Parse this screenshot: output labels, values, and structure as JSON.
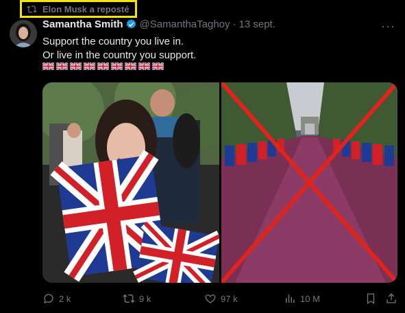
{
  "repost": {
    "label": "Elon Musk a reposté"
  },
  "tweet": {
    "author_name": "Samantha Smith",
    "handle": "@SamanthaTaghoy",
    "separator": "·",
    "date": "13 sept.",
    "line1": "Support the country you live in.",
    "line2": "Or live in the country you support.",
    "flag_count": 9
  },
  "colors": {
    "verified": "#1d9bf0",
    "highlight": "#f2e600",
    "muted": "#71767b",
    "cross": "#e0241b"
  },
  "icons": [
    "repost-icon",
    "verified-badge-icon",
    "more-icon",
    "reply-icon",
    "retweet-icon",
    "like-icon",
    "views-icon",
    "bookmark-icon",
    "share-icon"
  ],
  "actions": {
    "replies": "2 k",
    "reposts": "9 k",
    "likes": "97 k",
    "views": "10 M"
  }
}
